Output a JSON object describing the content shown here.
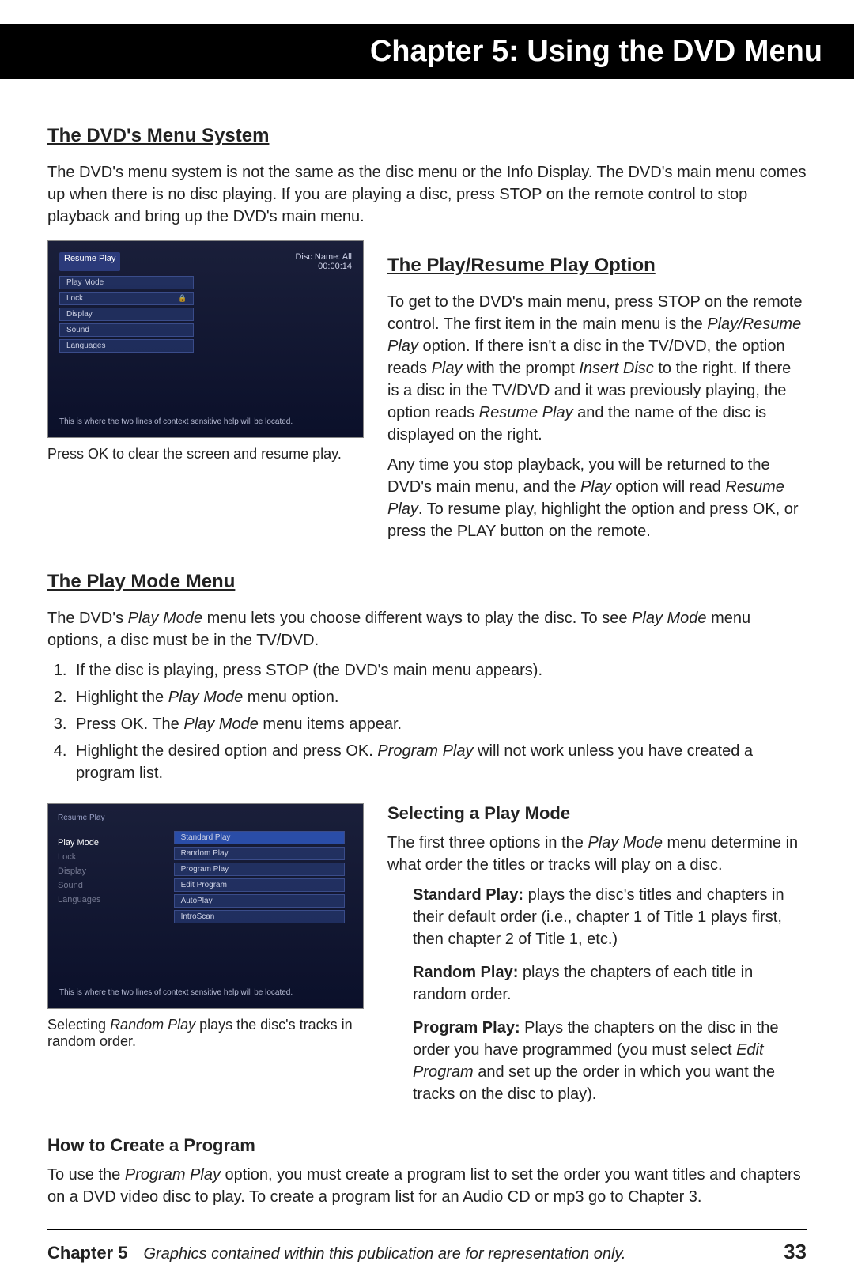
{
  "chapter_bar": "Chapter 5: Using the DVD Menu",
  "sec1": {
    "title": "The DVD's Menu System",
    "para": "The DVD's menu system is not the same as the disc menu or the Info Display. The DVD's main menu comes up when there is no disc playing. If you are playing a disc, press STOP on the remote control to stop playback and bring up the DVD's main menu."
  },
  "shot1": {
    "header_left": "Resume Play",
    "header_right_a": "Disc Name: All",
    "header_right_b": "00:00:14",
    "rows": [
      "Play Mode",
      "Lock",
      "Display",
      "Sound",
      "Languages"
    ],
    "note": "This is where the two lines of context sensitive help will be located.",
    "caption": "Press OK to clear the screen and resume play."
  },
  "sec2": {
    "title": "The Play/Resume Play Option",
    "p1_a": "To get to the DVD's main menu, press STOP on the remote control. The first item in the main menu is the ",
    "p1_b": "Play/Resume Play",
    "p1_c": " option. If there isn't a disc in the TV/DVD, the option reads ",
    "p1_d": "Play",
    "p1_e": " with the prompt ",
    "p1_f": "Insert Disc",
    "p1_g": " to the right. If there is a disc in the TV/DVD and it was previously playing, the option reads ",
    "p1_h": "Resume Play",
    "p1_i": " and the name of the disc is displayed on the right.",
    "p2_a": "Any time you stop playback, you will be returned to the DVD's main menu, and the ",
    "p2_b": "Play",
    "p2_c": " option will read ",
    "p2_d": "Resume Play",
    "p2_e": ". To resume play, highlight the option and press OK, or press the PLAY button on the remote."
  },
  "sec3": {
    "title": "The Play Mode Menu",
    "intro_a": "The DVD's ",
    "intro_b": "Play Mode",
    "intro_c": " menu lets you choose different ways to play the disc. To see ",
    "intro_d": "Play Mode",
    "intro_e": " menu options, a disc must be in the TV/DVD.",
    "li1": "If the disc is playing, press STOP (the DVD's main menu appears).",
    "li2_a": "Highlight the ",
    "li2_b": "Play Mode",
    "li2_c": " menu option.",
    "li3_a": "Press OK. The ",
    "li3_b": "Play Mode",
    "li3_c": " menu items appear.",
    "li4_a": "Highlight the desired option and press OK. ",
    "li4_b": "Program Play",
    "li4_c": " will not work unless you have created a program list."
  },
  "shot2": {
    "top_left": "Resume Play",
    "left_label": "Play Mode",
    "left_items": [
      "Lock",
      "Display",
      "Sound",
      "Languages"
    ],
    "right_items": [
      "Standard Play",
      "Random Play",
      "Program Play",
      "Edit Program",
      "AutoPlay",
      "IntroScan"
    ],
    "note": "This is where the two lines of context sensitive help will be located.",
    "caption_a": "Selecting ",
    "caption_b": "Random Play",
    "caption_c": " plays the disc's tracks in random order."
  },
  "sec4": {
    "title": "Selecting a Play Mode",
    "intro_a": "The first three options in the ",
    "intro_b": "Play Mode",
    "intro_c": " menu determine in what order the titles or tracks will play on a disc.",
    "d1_a": "Standard Play:",
    "d1_b": " plays the disc's titles and chapters in their default order (i.e., chapter 1 of Title 1 plays first, then chapter 2 of Title 1, etc.)",
    "d2_a": "Random Play:",
    "d2_b": " plays the chapters of each title in random order.",
    "d3_a": "Program Play:",
    "d3_b": "  Plays the chapters on the disc in the order you have programmed (you must select ",
    "d3_c": "Edit Program",
    "d3_d": " and set up the order in which you want the tracks on the disc to play)."
  },
  "sec5": {
    "title": "How to Create a Program",
    "p_a": "To use the ",
    "p_b": "Program Play",
    "p_c": " option, you must create a program list to set the order you want titles and chapters on a DVD video disc to play. To create a program list for an Audio CD or mp3 go to Chapter 3."
  },
  "footer": {
    "chapter": "Chapter 5",
    "note": "Graphics contained within this publication are for representation only.",
    "page": "33"
  }
}
